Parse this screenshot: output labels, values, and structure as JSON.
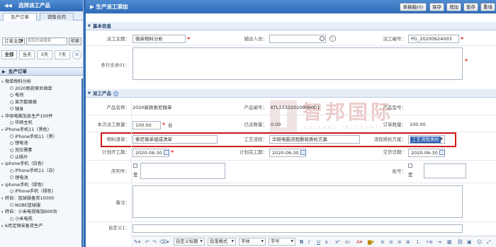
{
  "left": {
    "title": "选择派工产品",
    "tabs": [
      "生产订单",
      "销售合同"
    ],
    "search": {
      "select": "订单主题",
      "placeholder": "按回车键搜索",
      "button": "检索"
    },
    "filters": [
      "全部",
      "当天",
      "3天",
      "7天"
    ],
    "section": "生产订单",
    "tree": [
      {
        "label": "微单物料分析",
        "level": 0,
        "type": "expand"
      },
      {
        "label": "2020新款索尼微单",
        "level": 2,
        "type": "dot"
      },
      {
        "label": "电池",
        "level": 2,
        "type": "dot"
      },
      {
        "label": "显示靛器器",
        "level": 2,
        "type": "dot"
      },
      {
        "label": "镜身",
        "level": 2,
        "type": "dot"
      },
      {
        "label": "华硕电脑加急生产100件",
        "level": 0,
        "type": "expand"
      },
      {
        "label": "华硕主机",
        "level": 2,
        "type": "dot"
      },
      {
        "label": "iPhone手机11（黑色）",
        "level": 0,
        "type": "expand"
      },
      {
        "label": "iPhone手机11（黑）",
        "level": 2,
        "type": "dot"
      },
      {
        "label": "锂电池",
        "level": 2,
        "type": "dot"
      },
      {
        "label": "充拉需素",
        "level": 2,
        "type": "dot"
      },
      {
        "label": "止晤片",
        "level": 2,
        "type": "dot"
      },
      {
        "label": "iphone手机（白色）",
        "level": 0,
        "type": "expand"
      },
      {
        "label": "iPhone手机11（白）",
        "level": 2,
        "type": "dot"
      },
      {
        "label": "锂电池",
        "level": 2,
        "type": "dot"
      },
      {
        "label": "iphone手机（绿色）",
        "level": 0,
        "type": "expand"
      },
      {
        "label": "iPhone手机（绿色）",
        "level": 2,
        "type": "dot"
      },
      {
        "label": "转自：篮球服备货10000",
        "level": 0,
        "type": "expand"
      },
      {
        "label": "NOBE篮球服",
        "level": 2,
        "type": "dot"
      },
      {
        "label": "转自：小米电视临加600台",
        "level": 0,
        "type": "expand"
      },
      {
        "label": "小米电视",
        "level": 2,
        "type": "dot"
      },
      {
        "label": "6月定销采备货生产",
        "level": 0,
        "type": "expand"
      }
    ]
  },
  "right": {
    "title": "生产派工添加",
    "toolbar": [
      "草稿箱(0)",
      "保存",
      "增加",
      "暂存",
      "重填"
    ],
    "basic": {
      "header": "基本信息",
      "subject_label": "派工主题：",
      "subject_value": "微单物料分析",
      "helper_label": "辅派人员：",
      "number_label": "派工编号：",
      "number_value": "PG_20200624003",
      "text_label": "多行文本01："
    },
    "product": {
      "header": "派工产品",
      "name_label": "产品名称：",
      "name_value": "2020新款索尼微单",
      "code_label": "产品编号：",
      "code_value": "KTL33332020000001",
      "model_label": "产品型号：",
      "qty_label": "本次派工数量：",
      "qty_value": "100.00",
      "unit": "台",
      "dispatched_label": "已派数量：",
      "dispatched_value": "0.00",
      "order_qty_label": "订单数量：",
      "order_qty_value": "100.00",
      "bom_label": "物料清单：",
      "bom_value": "索尼微单组成清单",
      "process_label": "工艺流程：",
      "process_value": "华硕电脑流程删除质检方案",
      "qc_label": "流程质检方案：",
      "qc_value": "工艺流程质检",
      "start_label": "计划开工期：",
      "start_value": "2020-06-30",
      "end_label": "计划完工期：",
      "end_value": "2020-06-30",
      "delivery_label": "交货日期：",
      "delivery_value": "2020-06-30",
      "serial_label": "序列号：",
      "serial_yes": "是",
      "batch_label": "批号：",
      "batch_yes": "是",
      "remark_label": "备注：",
      "custom_label": "自定义1："
    },
    "editor": {
      "heading": "自定义标题",
      "para": "段落格式",
      "font": "字体",
      "size": "字号"
    }
  },
  "watermark": {
    "cn": "智邦国际",
    "en": "ZHIBANG INTERNATIONAL"
  },
  "colors": {
    "header": "#2f6bb7",
    "highlight": "#d21b1b",
    "required": "#e02020"
  }
}
